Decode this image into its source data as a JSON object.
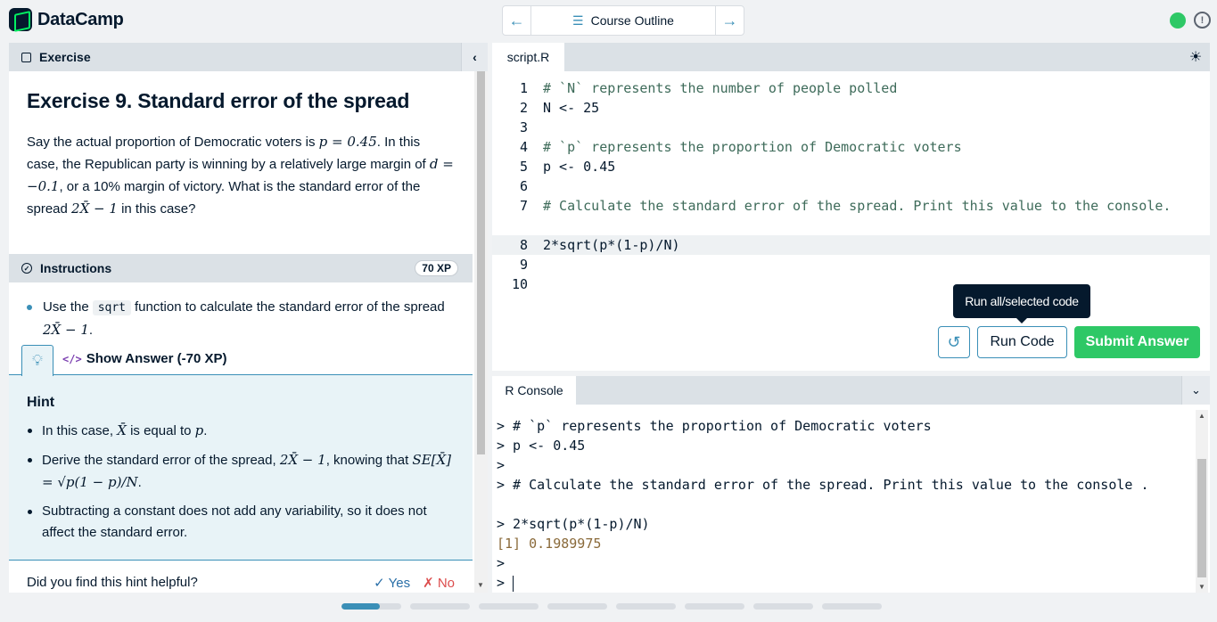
{
  "brand": {
    "name": "DataCamp",
    "accent": "#03ef62"
  },
  "nav": {
    "outline_label": "Course Outline",
    "prev_icon": "arrow-left-icon",
    "next_icon": "arrow-right-icon"
  },
  "exercise": {
    "header": "Exercise",
    "title": "Exercise 9. Standard error of the spread",
    "text": {
      "p1": "Say the actual proportion of Democratic voters is ",
      "m1": "p = 0.45",
      "p2": ". In this case, the Republican party is winning by a relatively large margin of ",
      "m2": "d = −0.1",
      "p3": ", or a 10% margin of victory. What is the standard error of the spread ",
      "m3": "2X̄ − 1",
      "p4": " in this case?"
    }
  },
  "instructions": {
    "header": "Instructions",
    "xp": "70 XP",
    "item_pre": "Use the",
    "item_code": "sqrt",
    "item_post": "function to calculate the standard error of the spread ",
    "item_math": "2X̄ − 1",
    "item_end": "."
  },
  "hint_tabs": {
    "show_answer": "Show Answer (-70 XP)",
    "code_icon": "</>"
  },
  "hint": {
    "title": "Hint",
    "i1_pre": "In this case, ",
    "i1_m1": "X̄",
    "i1_mid": " is equal to ",
    "i1_m2": "p",
    "i1_end": ".",
    "i2_pre": "Derive the standard error of the spread, ",
    "i2_m1": "2X̄ − 1",
    "i2_mid": ", knowing that ",
    "i2_m2": "SE[X̄] = √p(1 − p)/N",
    "i2_end": ".",
    "i3": "Subtracting a constant does not add any variability, so it does not affect the standard error.",
    "helpful": "Did you find this hint helpful?",
    "yes": "✓ Yes",
    "no": "✗ No"
  },
  "editor": {
    "tab": "script.R",
    "lines": [
      {
        "n": "1",
        "code": "# `N` represents the number of people polled",
        "comment": true
      },
      {
        "n": "2",
        "code": "N <- 25",
        "comment": false
      },
      {
        "n": "3",
        "code": "",
        "comment": false
      },
      {
        "n": "4",
        "code": "# `p` represents the proportion of Democratic voters",
        "comment": true
      },
      {
        "n": "5",
        "code": "p <- 0.45",
        "comment": false
      },
      {
        "n": "6",
        "code": "",
        "comment": false
      },
      {
        "n": "7",
        "code": "# Calculate the standard error of the spread. Print this value to the console.",
        "comment": true
      },
      {
        "n": "8",
        "code": "2*sqrt(p*(1-p)/N)",
        "comment": false
      },
      {
        "n": "9",
        "code": "",
        "comment": false
      },
      {
        "n": "10",
        "code": "",
        "comment": false
      }
    ],
    "tooltip": "Run all/selected code",
    "run_label": "Run Code",
    "submit_label": "Submit Answer",
    "submit_color": "#2ec866"
  },
  "console": {
    "tab": "R Console",
    "lines": [
      {
        "text": "> # `p` represents the proportion of Democratic voters",
        "type": "cmd"
      },
      {
        "text": "> p <- 0.45",
        "type": "cmd"
      },
      {
        "text": ">",
        "type": "cmd"
      },
      {
        "text": "> # Calculate the standard error of the spread. Print this value to the console .",
        "type": "wrap"
      },
      {
        "text": "> 2*sqrt(p*(1-p)/N)",
        "type": "cmd"
      },
      {
        "text": "[1] 0.1989975",
        "type": "out"
      },
      {
        "text": ">",
        "type": "cmd"
      },
      {
        "text": "> ",
        "type": "prompt"
      }
    ]
  },
  "progress": {
    "segments": 8,
    "current": 1,
    "current_fill": 0.64
  }
}
